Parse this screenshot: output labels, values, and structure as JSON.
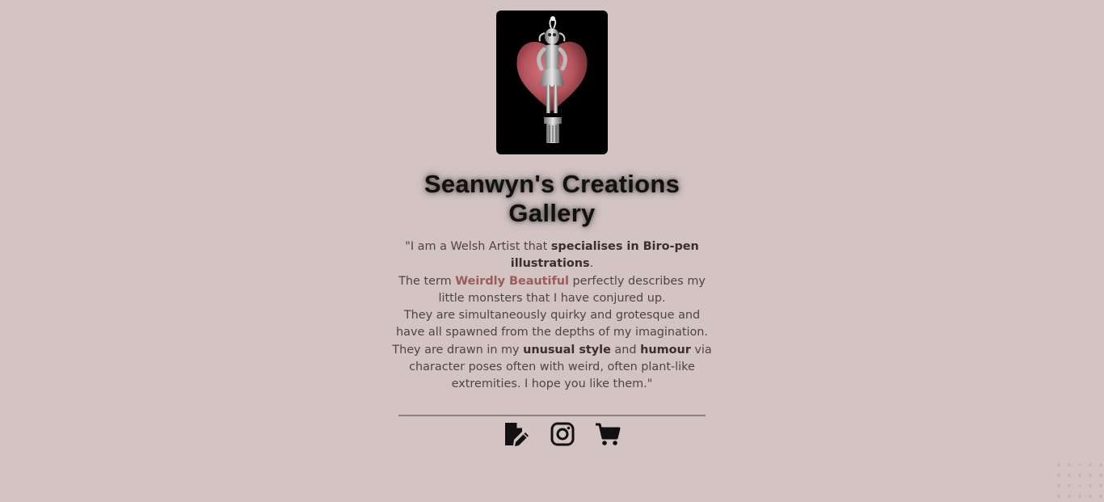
{
  "site": {
    "title": "Seanwyn's Creations Gallery"
  },
  "bio": {
    "p1_a": "\"I am a Welsh Artist that ",
    "p1_b": "specialises in Biro-pen illustrations",
    "p1_c": ".",
    "p2_a": "The term ",
    "p2_b": "Weirdly Beautiful",
    "p2_c": " perfectly describes my little monsters that I have conjured up.",
    "p3": "They are simultaneously quirky and grotesque and have all spawned from the depths of my imagination.",
    "p4_a": "They are drawn in my ",
    "p4_b": "unusual style",
    "p4_c": " and ",
    "p4_d": "humour",
    "p4_e": " via character poses often with weird, often plant-like extremities. I hope you like them.\""
  },
  "links": [
    {
      "icon": "file-signature-icon"
    },
    {
      "icon": "instagram-icon"
    },
    {
      "icon": "shopping-cart-icon"
    }
  ],
  "colors": {
    "background": "#d3c4c3",
    "text": "#4f4343",
    "accent": "#9c5a5e",
    "title": "#111111"
  }
}
